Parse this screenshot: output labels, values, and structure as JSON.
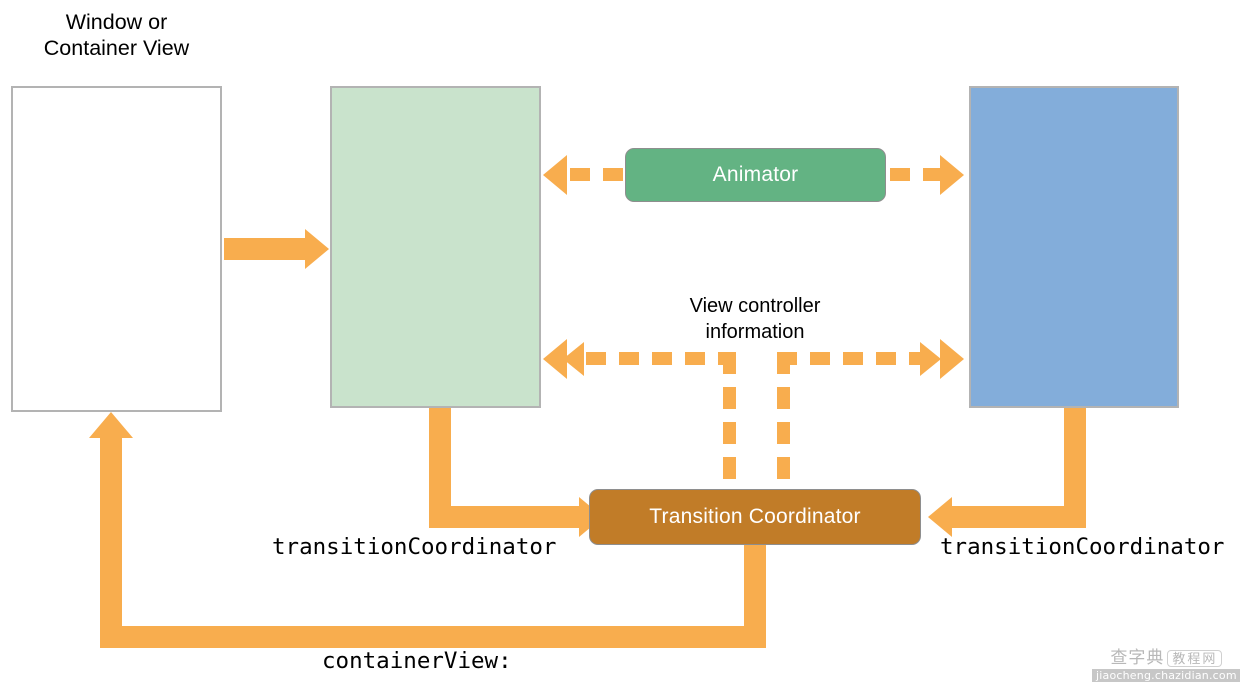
{
  "diagram": {
    "title": "View controller transition with transition coordinator",
    "boxes": {
      "window": {
        "label": "Window or\nContainer View",
        "fill": "#ffffff",
        "border": "#b3b3b3"
      },
      "from_view_controller": {
        "label": "",
        "fill": "#c9e3cc",
        "border": "#b3b3b3"
      },
      "to_view_controller": {
        "label": "",
        "fill": "#83adda",
        "border": "#b3b3b3"
      },
      "animator": {
        "label": "Animator",
        "fill": "#63b383",
        "text_color": "#ffffff"
      },
      "transition_coordinator": {
        "label": "Transition Coordinator",
        "fill": "#c17c28",
        "text_color": "#ffffff"
      }
    },
    "labels": {
      "view_controller_information": "View controller\ninformation",
      "transition_coordinator_left": "transitionCoordinator",
      "transition_coordinator_right": "transitionCoordinator",
      "container_view": "containerView:"
    },
    "colors": {
      "arrow": "#f8ad4e",
      "green_fill": "#c9e3cc",
      "blue_fill": "#83adda",
      "animator_green": "#63b383",
      "coordinator_brown": "#c17c28",
      "box_border": "#b3b3b3",
      "text": "#000000"
    },
    "watermark": {
      "cn_text": "查字典",
      "pill_text": "教程网",
      "url_text": "jiaocheng.chazidian.com"
    }
  }
}
